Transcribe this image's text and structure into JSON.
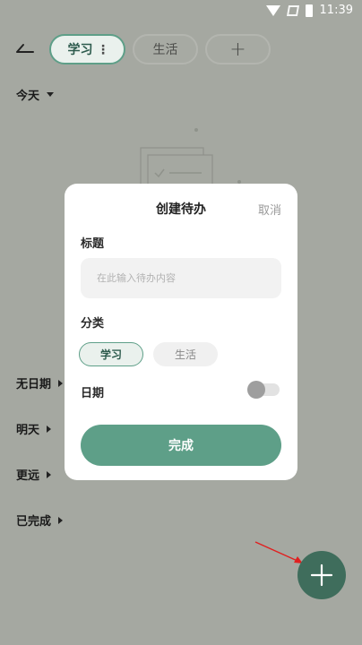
{
  "status_bar": {
    "time": "11:39"
  },
  "header": {
    "tags": [
      {
        "label": "学习",
        "selected": true
      },
      {
        "label": "生活",
        "selected": false
      },
      {
        "label": "+",
        "selected": false
      }
    ]
  },
  "sections": {
    "today": "今天",
    "no_date": "无日期",
    "tomorrow": "明天",
    "later": "更远",
    "completed": "已完成"
  },
  "dialog": {
    "title": "创建待办",
    "cancel": "取消",
    "title_label": "标题",
    "title_input": {
      "value": "",
      "placeholder": "在此输入待办内容"
    },
    "category_label": "分类",
    "categories": [
      {
        "label": "学习",
        "selected": true
      },
      {
        "label": "生活",
        "selected": false
      }
    ],
    "date_label": "日期",
    "date_toggle_on": false,
    "done_button": "完成"
  },
  "colors": {
    "accent": "#5e9f88",
    "fab": "#3f6d5c",
    "overlay_background": "#a5a8a1",
    "annotation_arrow": "#e02020"
  },
  "icons": {
    "back": "back-arrow-icon",
    "more": "vertical-dots-icon",
    "add": "plus-icon",
    "wifi": "wifi-icon",
    "signal": "signal-off-icon",
    "battery": "battery-icon"
  }
}
